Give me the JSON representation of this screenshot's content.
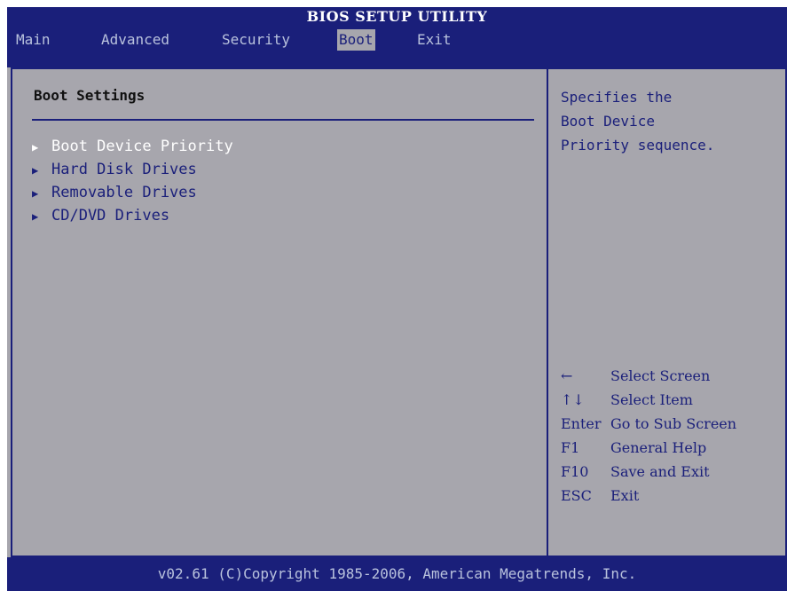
{
  "title": "BIOS SETUP UTILITY",
  "menu": {
    "items": [
      "Main",
      "Advanced",
      "Security",
      "Boot",
      "Exit"
    ],
    "active": "Boot"
  },
  "main": {
    "section_title": "Boot Settings",
    "items": [
      {
        "label": "Boot Device Priority",
        "selected": true
      },
      {
        "label": "Hard Disk Drives",
        "selected": false
      },
      {
        "label": "Removable Drives",
        "selected": false
      },
      {
        "label": "CD/DVD Drives",
        "selected": false
      }
    ]
  },
  "help": {
    "lines": [
      "Specifies the",
      "Boot Device",
      "Priority sequence."
    ]
  },
  "keys": [
    {
      "key": "←",
      "action": "Select Screen"
    },
    {
      "key": "↑↓",
      "action": "Select Item"
    },
    {
      "key": "Enter",
      "action": "Go to Sub Screen"
    },
    {
      "key": "F1",
      "action": "General Help"
    },
    {
      "key": "F10",
      "action": "Save and Exit"
    },
    {
      "key": "ESC",
      "action": "Exit"
    }
  ],
  "footer": "v02.61 (C)Copyright 1985-2006, American Megatrends, Inc.",
  "colors": {
    "frame_blue": "#1a1f7a",
    "panel_gray": "#a7a6ad",
    "selected_text": "#ffffff"
  },
  "icons": {
    "submenu_marker": "triangle-right-icon"
  }
}
